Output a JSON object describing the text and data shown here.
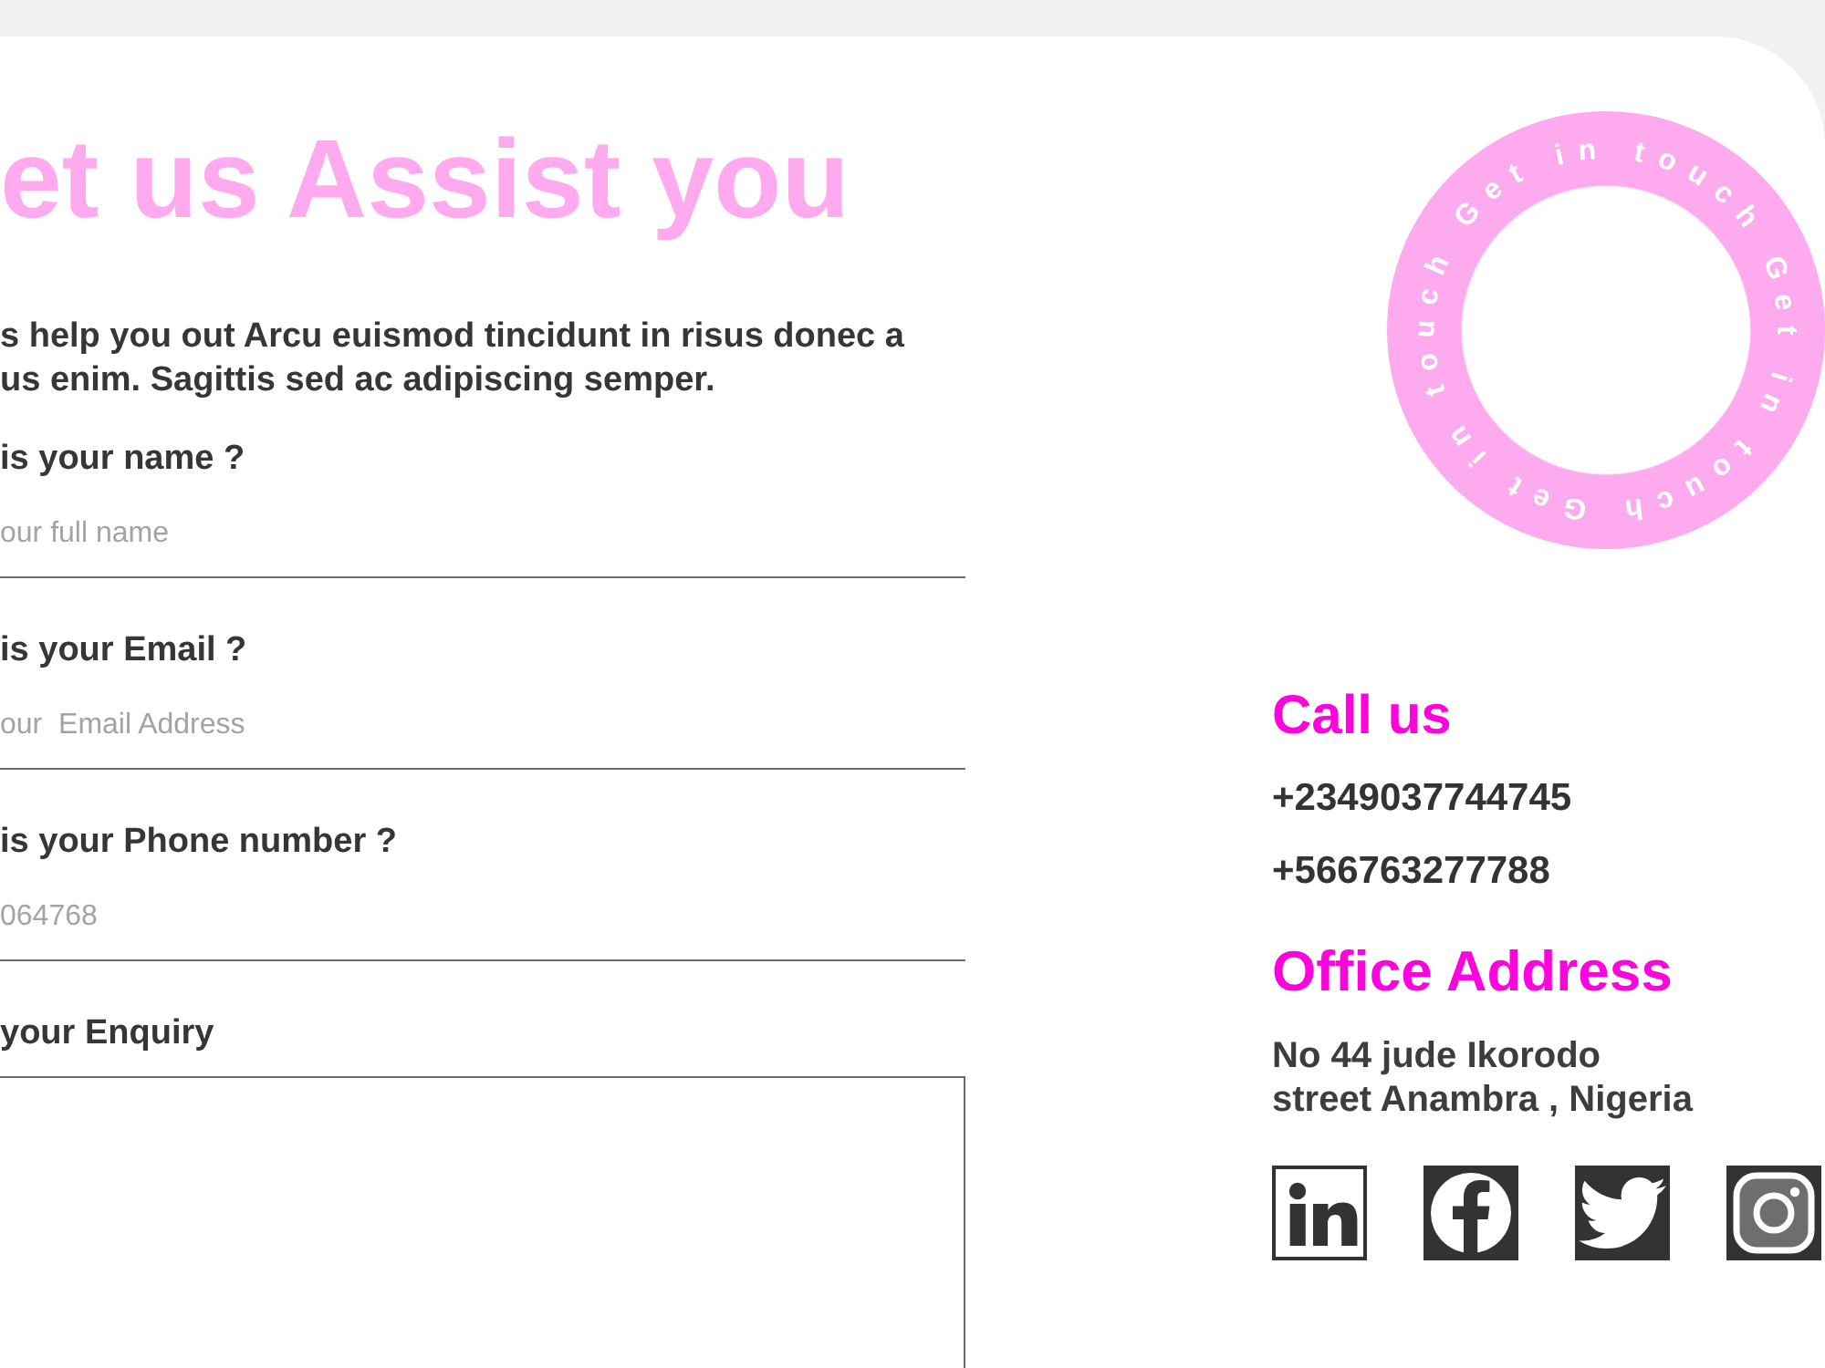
{
  "form": {
    "title": "et us Assist you",
    "intro": "s help you out Arcu euismod tincidunt in risus donec a us enim. Sagittis sed ac adipiscing semper.",
    "fields": [
      {
        "kind": "line",
        "label": "is your name ?",
        "placeholder": "our full name"
      },
      {
        "kind": "line",
        "label": "is your Email ?",
        "placeholder": "our  Email Address"
      },
      {
        "kind": "line",
        "label": "is your Phone number ?",
        "placeholder": "064768"
      },
      {
        "kind": "area",
        "label": "your Enquiry"
      }
    ]
  },
  "badge": {
    "ring_text": "Get in touch Get in touch Get in touch"
  },
  "contact": {
    "call_title": "Call us",
    "phones": [
      "+2349037744745",
      "+566763277788"
    ],
    "address_title": "Office Address",
    "address_lines": [
      "No 44 jude Ikorodo",
      "street Anambra , Nigeria"
    ]
  },
  "social": [
    {
      "kind": "linkedin"
    },
    {
      "kind": "facebook"
    },
    {
      "kind": "twitter"
    },
    {
      "kind": "instagram"
    }
  ]
}
